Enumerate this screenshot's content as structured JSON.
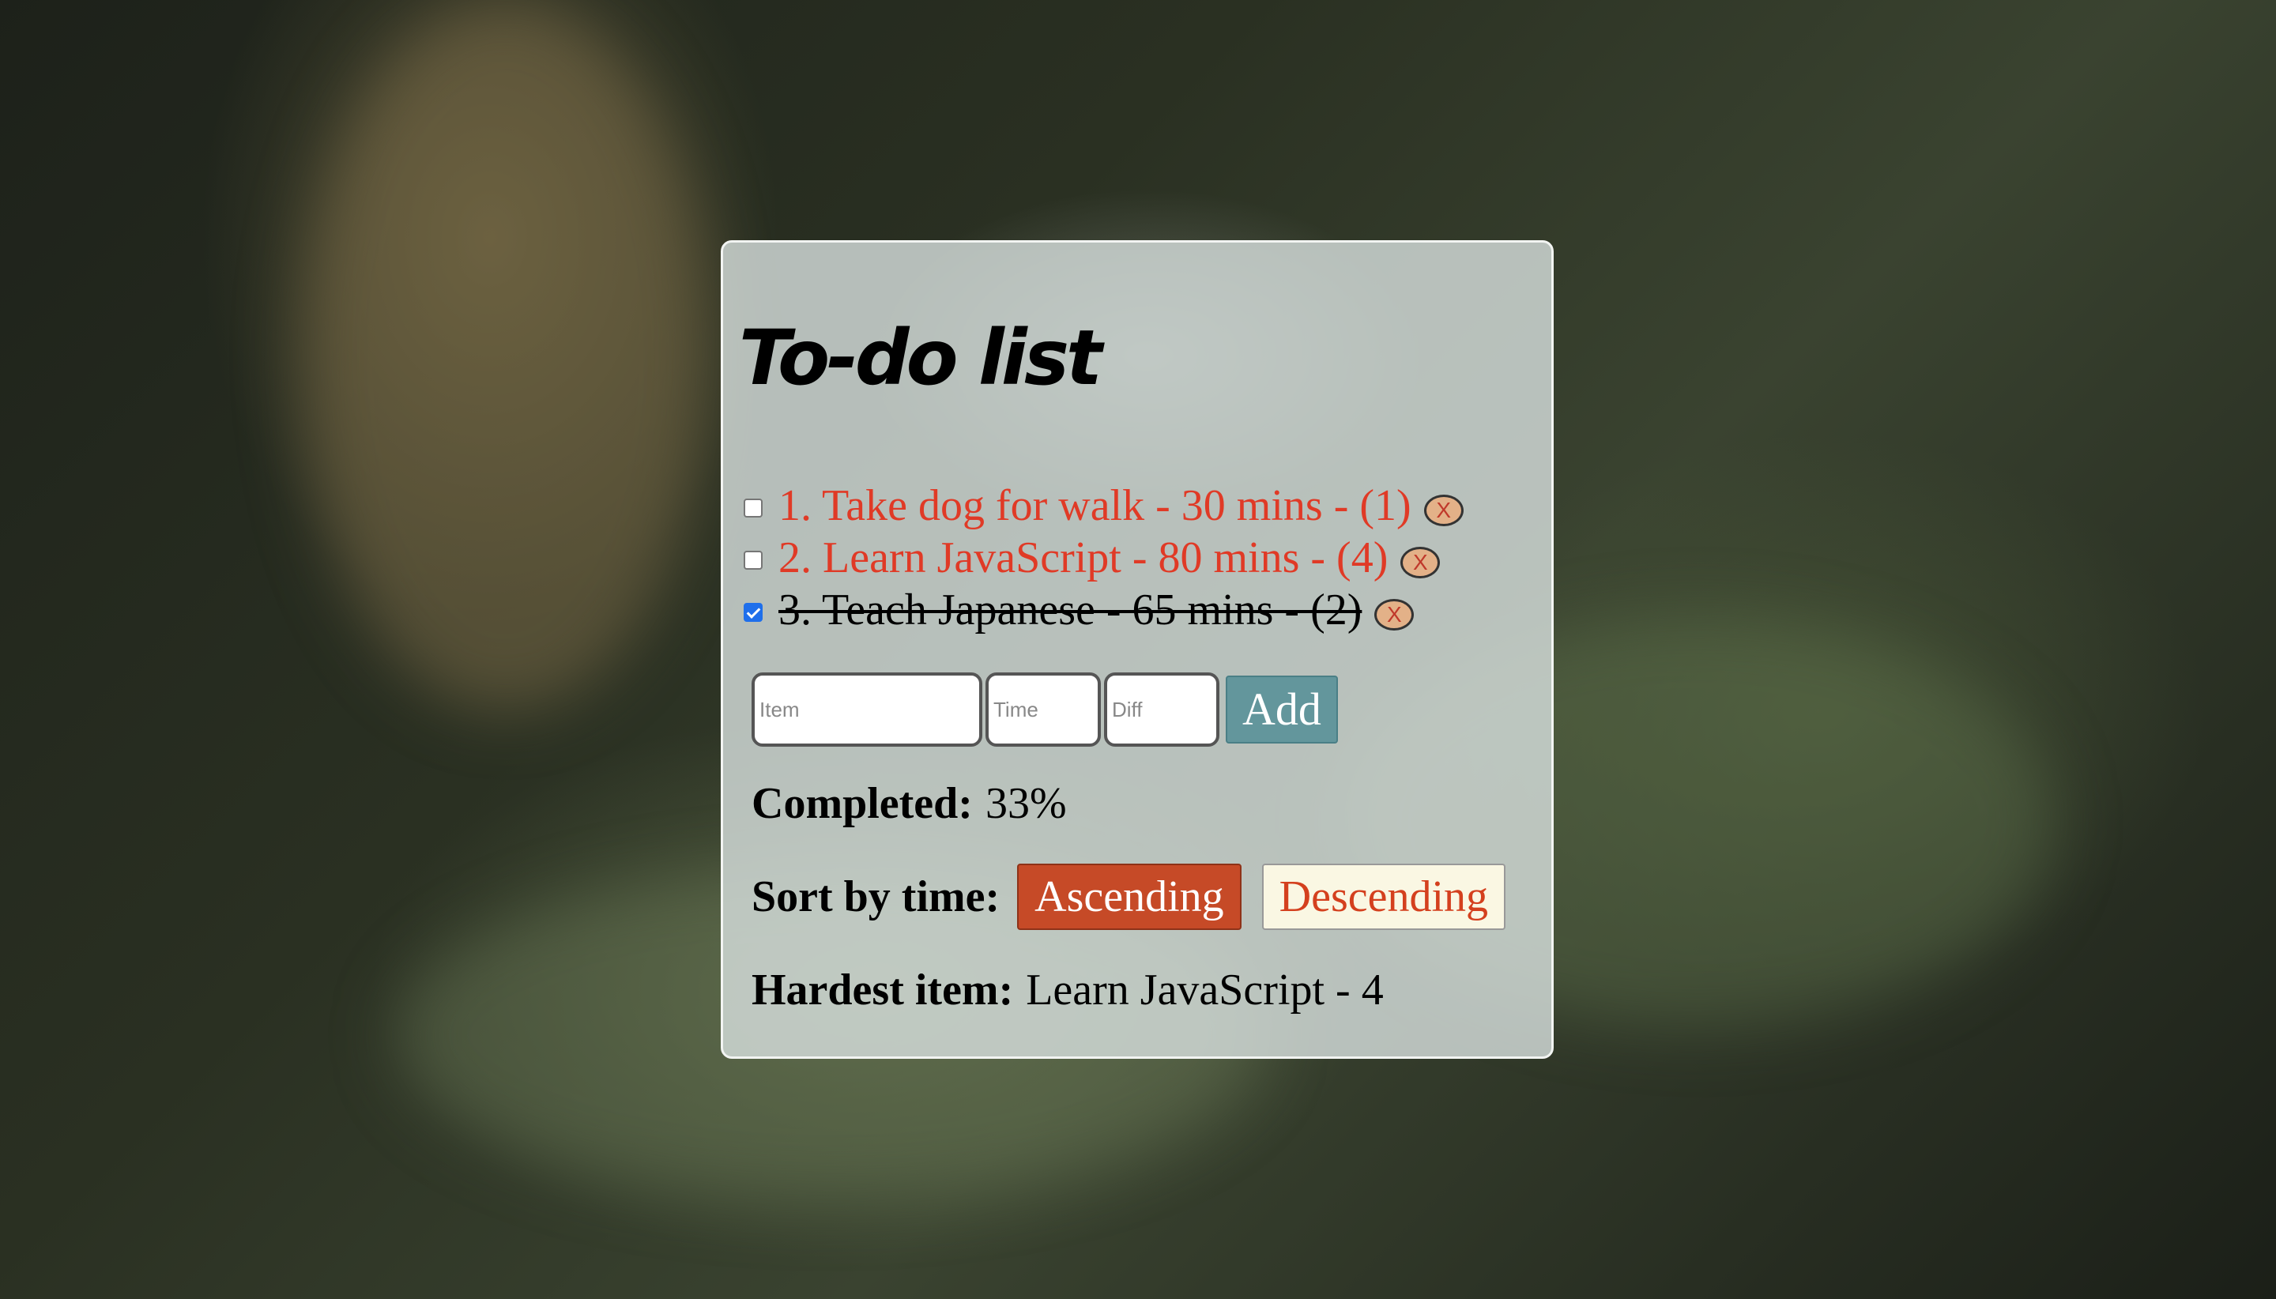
{
  "app": {
    "title": "To-do list"
  },
  "todos": [
    {
      "text": "1. Take dog for walk - 30 mins - (1)",
      "completed": false,
      "delete_label": "X"
    },
    {
      "text": "2. Learn JavaScript - 80 mins - (4)",
      "completed": false,
      "delete_label": "X"
    },
    {
      "text": "3. Teach Japanese - 65 mins - (2)",
      "completed": true,
      "delete_label": "X"
    }
  ],
  "form": {
    "item_placeholder": "Item",
    "time_placeholder": "Time",
    "diff_placeholder": "Diff",
    "add_label": "Add"
  },
  "stats": {
    "completed_label": "Completed:",
    "completed_value": "33%",
    "sort_label": "Sort by time:",
    "sort_ascending": "Ascending",
    "sort_descending": "Descending",
    "hardest_label": "Hardest item:",
    "hardest_value": "Learn JavaScript - 4"
  },
  "colors": {
    "pending_text": "#e03a26",
    "add_button": "#63969c",
    "ascending_button": "#c64a27",
    "descending_button": "#faf7e3"
  }
}
